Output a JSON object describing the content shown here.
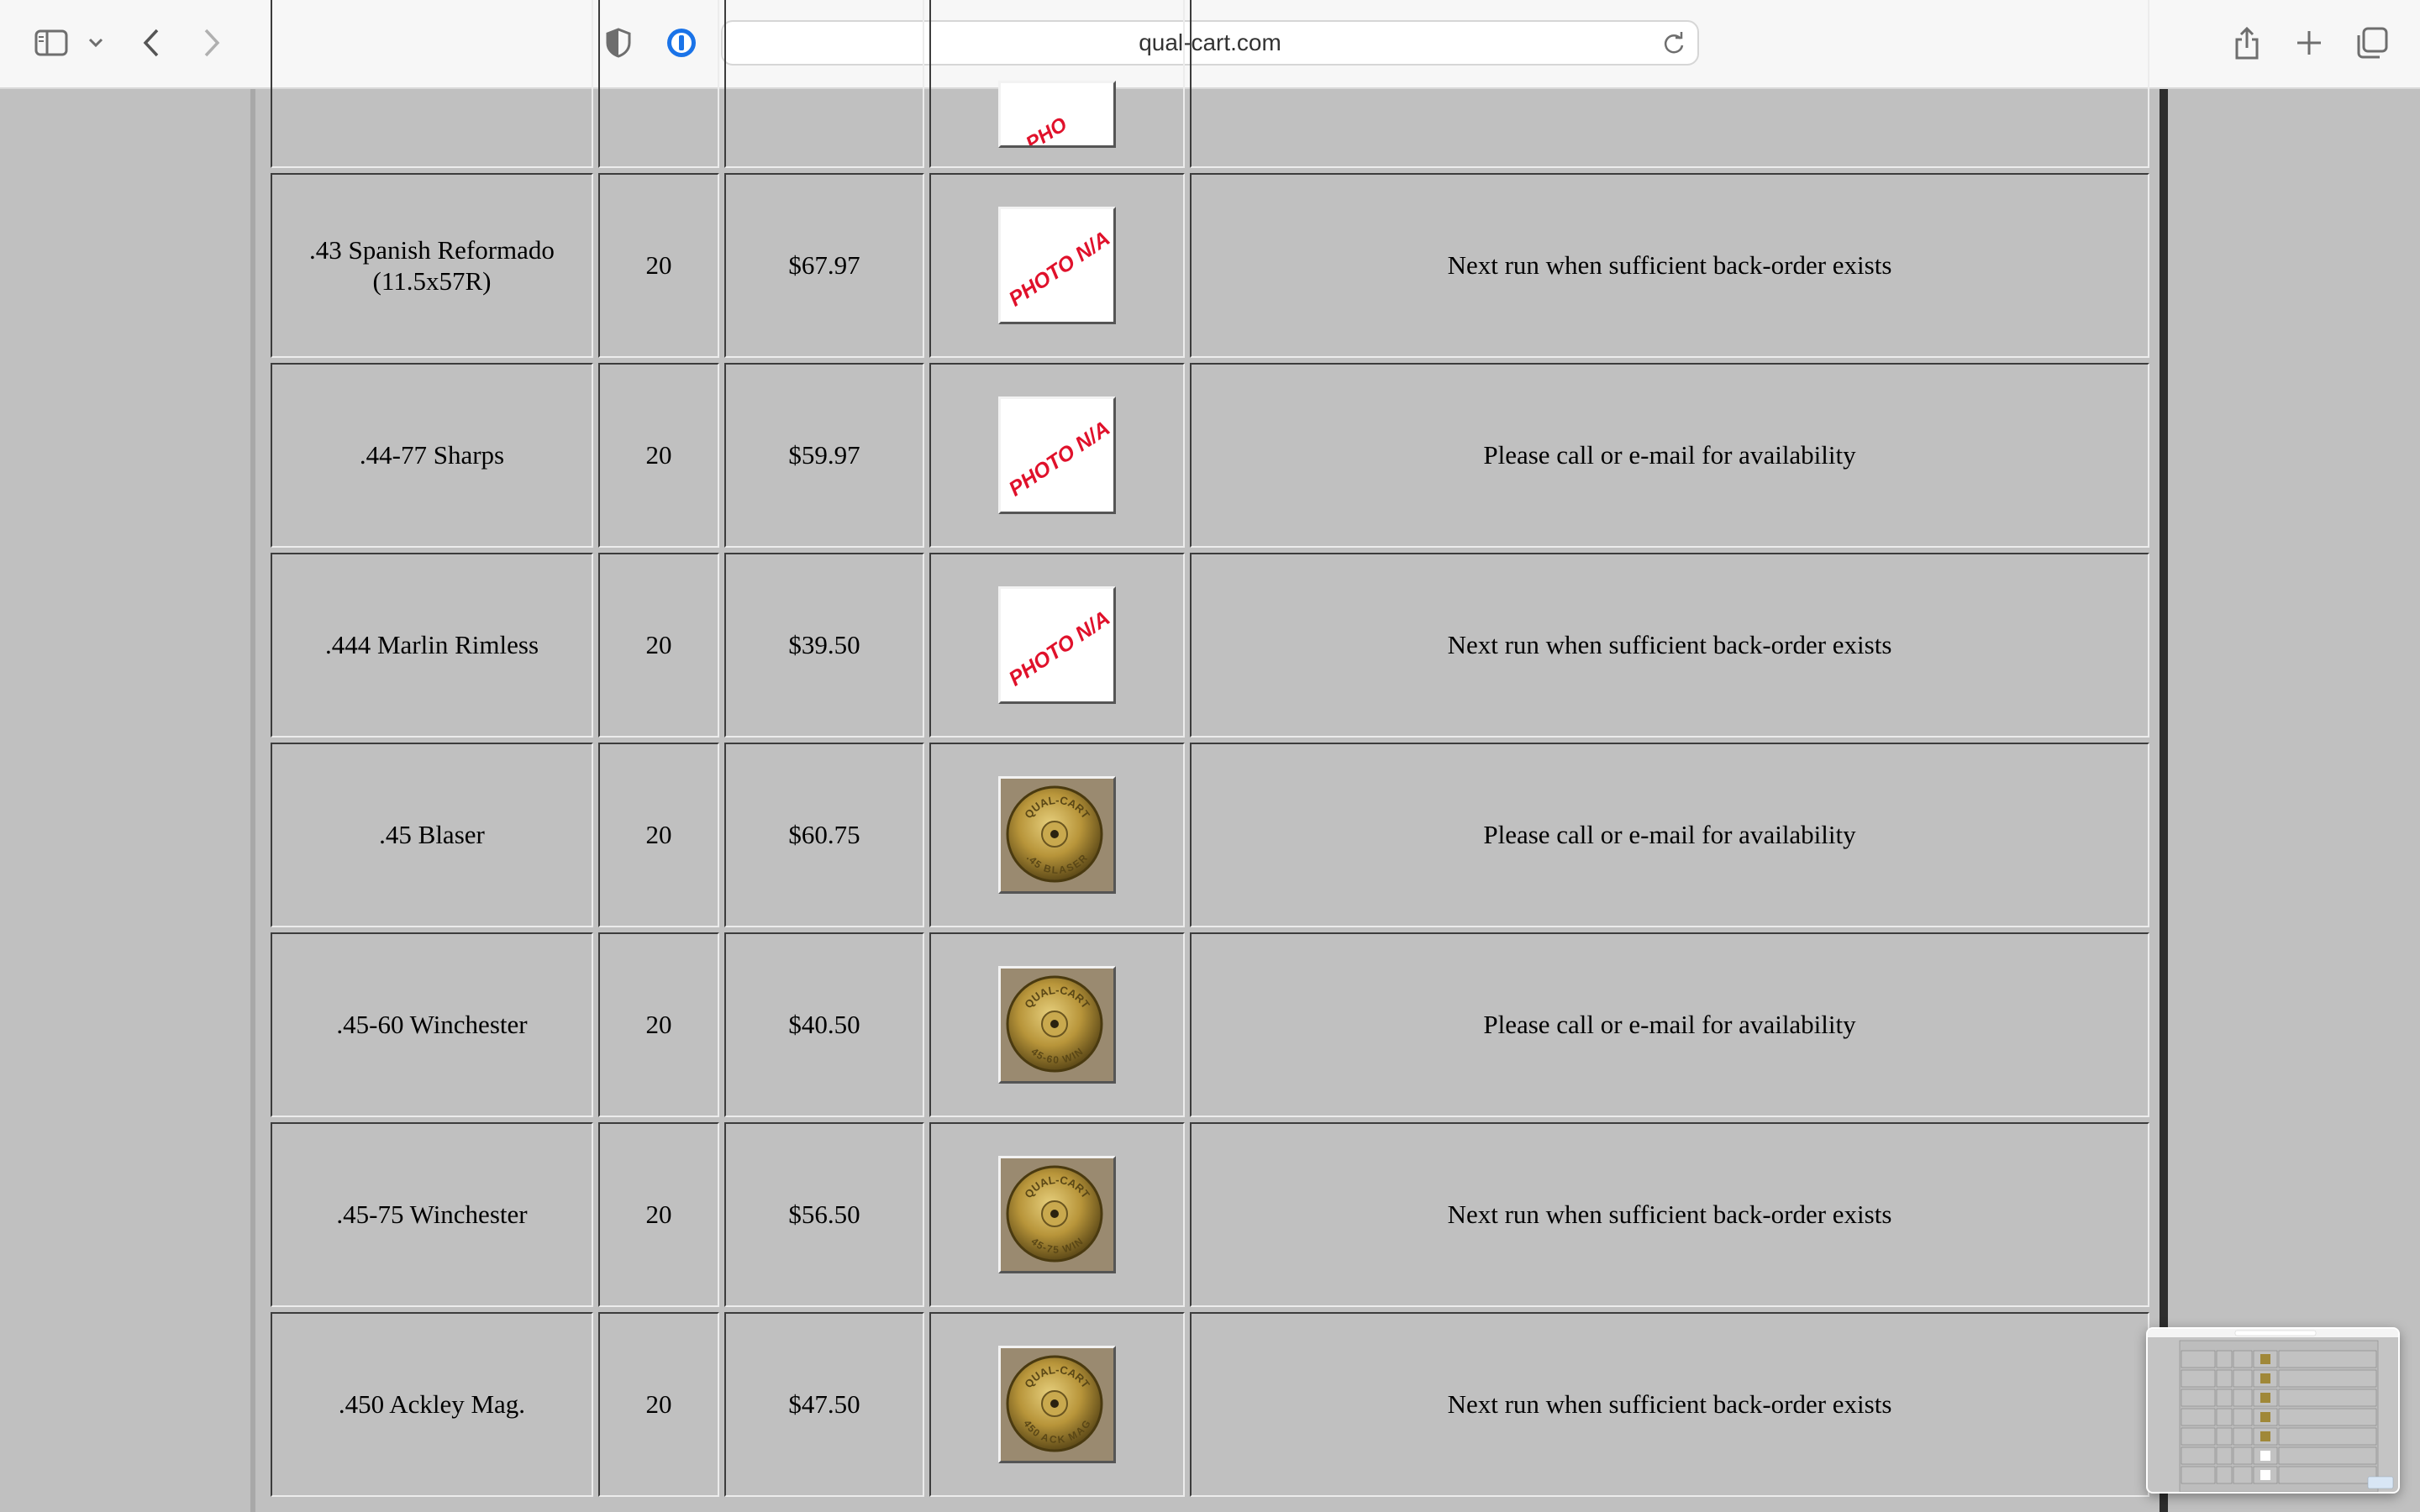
{
  "browser": {
    "url": "qual-cart.com",
    "icons": [
      "sidebar-icon",
      "chevron-down-icon",
      "back-icon",
      "forward-icon",
      "privacy-shield-icon",
      "password-manager-icon",
      "reload-icon",
      "share-icon",
      "new-tab-icon",
      "tab-overview-icon"
    ]
  },
  "products": {
    "partial_row_image_text": "PHO",
    "rows": [
      {
        "name": ".43 Spanish Reformado (11.5x57R)",
        "qty": "20",
        "price": "$67.97",
        "photo": "na",
        "photo_text": "PHOTO N/A",
        "availability": "Next run when sufficient back-order exists"
      },
      {
        "name": ".44-77 Sharps",
        "qty": "20",
        "price": "$59.97",
        "photo": "na",
        "photo_text": "PHOTO N/A",
        "availability": "Please call or e-mail for availability"
      },
      {
        "name": ".444 Marlin Rimless",
        "qty": "20",
        "price": "$39.50",
        "photo": "na",
        "photo_text": "PHOTO N/A",
        "availability": "Next run when sufficient back-order exists"
      },
      {
        "name": ".45 Blaser",
        "qty": "20",
        "price": "$60.75",
        "photo": "brass",
        "stamp_top": "QUAL-CART",
        "stamp_bottom": ".45 BLASER",
        "availability": "Please call or e-mail for availability"
      },
      {
        "name": ".45-60 Winchester",
        "qty": "20",
        "price": "$40.50",
        "photo": "brass",
        "stamp_top": "QUAL-CART",
        "stamp_bottom": "45-60 WIN",
        "availability": "Please call or e-mail for availability"
      },
      {
        "name": ".45-75 Winchester",
        "qty": "20",
        "price": "$56.50",
        "photo": "brass",
        "stamp_top": "QUAL-CART",
        "stamp_bottom": "45-75 WIN",
        "availability": "Next run when sufficient back-order exists"
      },
      {
        "name": ".450 Ackley Mag.",
        "qty": "20",
        "price": "$47.50",
        "photo": "brass",
        "stamp_top": "QUAL-CART",
        "stamp_bottom": "450 ACK MAG",
        "availability": "Next run when sufficient back-order exists"
      }
    ]
  },
  "colors": {
    "page_background": "#c0c0c0",
    "photo_na_text": "#e0112b",
    "brass": "#b8953a"
  }
}
